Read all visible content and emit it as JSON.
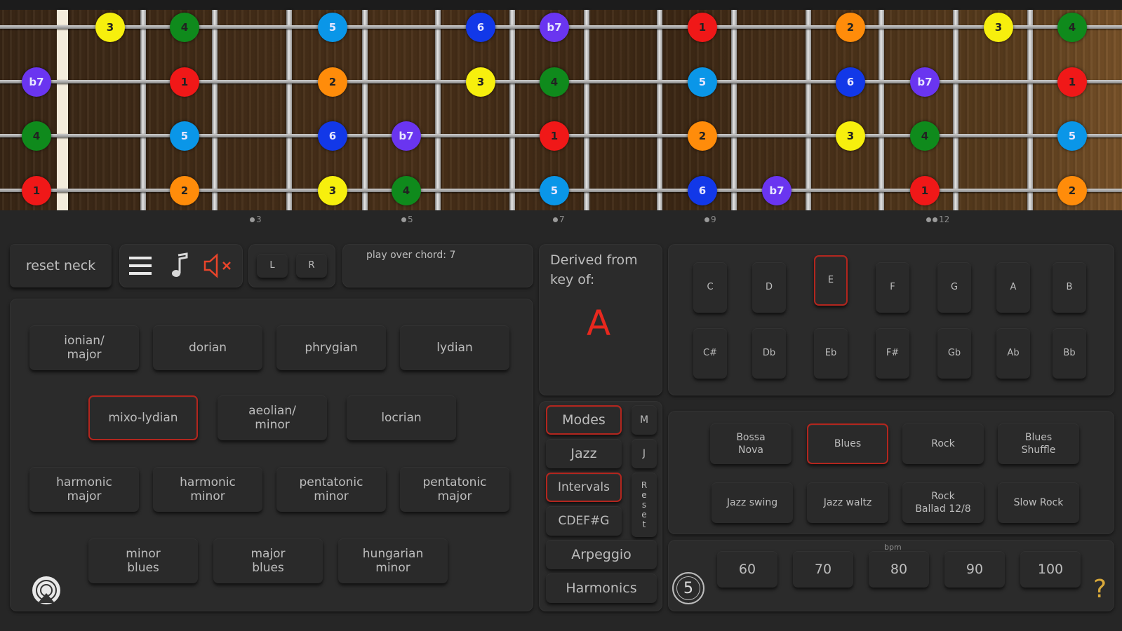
{
  "fret_markers": [
    "3",
    "5",
    "7",
    "9",
    "12"
  ],
  "strings": [
    {
      "notes": [
        {
          "label": "3",
          "color": "#f7ef0d"
        },
        {
          "label": "4",
          "color": "#0f8a1c"
        },
        {
          "label": "5",
          "color": "#0a96e8"
        },
        {
          "label": "6",
          "color": "#1238e8"
        },
        {
          "label": "b7",
          "color": "#6a35f0"
        },
        {
          "label": "1",
          "color": "#f01818"
        },
        {
          "label": "2",
          "color": "#ff8c0a"
        },
        {
          "label": "3",
          "color": "#f7ef0d"
        },
        {
          "label": "4",
          "color": "#0f8a1c"
        }
      ]
    },
    {
      "notes": [
        {
          "label": "b7",
          "color": "#6a35f0"
        },
        {
          "label": "1",
          "color": "#f01818"
        },
        {
          "label": "2",
          "color": "#ff8c0a"
        },
        {
          "label": "3",
          "color": "#f7ef0d"
        },
        {
          "label": "4",
          "color": "#0f8a1c"
        },
        {
          "label": "5",
          "color": "#0a96e8"
        },
        {
          "label": "6",
          "color": "#1238e8"
        },
        {
          "label": "b7",
          "color": "#6a35f0"
        },
        {
          "label": "1",
          "color": "#f01818"
        }
      ]
    },
    {
      "notes": [
        {
          "label": "4",
          "color": "#0f8a1c"
        },
        {
          "label": "5",
          "color": "#0a96e8"
        },
        {
          "label": "6",
          "color": "#1238e8"
        },
        {
          "label": "b7",
          "color": "#6a35f0"
        },
        {
          "label": "1",
          "color": "#f01818"
        },
        {
          "label": "2",
          "color": "#ff8c0a"
        },
        {
          "label": "3",
          "color": "#f7ef0d"
        },
        {
          "label": "4",
          "color": "#0f8a1c"
        },
        {
          "label": "5",
          "color": "#0a96e8"
        }
      ]
    },
    {
      "notes": [
        {
          "label": "1",
          "color": "#f01818"
        },
        {
          "label": "2",
          "color": "#ff8c0a"
        },
        {
          "label": "3",
          "color": "#f7ef0d"
        },
        {
          "label": "4",
          "color": "#0f8a1c"
        },
        {
          "label": "5",
          "color": "#0a96e8"
        },
        {
          "label": "6",
          "color": "#1238e8"
        },
        {
          "label": "b7",
          "color": "#6a35f0"
        },
        {
          "label": "1",
          "color": "#f01818"
        },
        {
          "label": "2",
          "color": "#ff8c0a"
        }
      ]
    }
  ],
  "controls": {
    "reset_neck": "reset neck",
    "left": "L",
    "right": "R",
    "play_over": "play over chord: 7"
  },
  "derived": {
    "line1": "Derived from",
    "line2": "key of:",
    "key": "A"
  },
  "scales": [
    "ionian/\nmajor",
    "dorian",
    "phrygian",
    "lydian",
    "mixo-lydian",
    "aeolian/\nminor",
    "locrian",
    "harmonic\nmajor",
    "harmonic\nminor",
    "pentatonic\nminor",
    "pentatonic\nmajor",
    "minor\nblues",
    "major\nblues",
    "hungarian\nminor"
  ],
  "modes": {
    "modes": "Modes",
    "jazz": "Jazz",
    "intervals": "Intervals",
    "cdefg": "CDEF#G",
    "arpeggio": "Arpeggio",
    "harmonics": "Harmonics",
    "m": "M",
    "j": "J",
    "reset": "R\ne\ns\ne\nt"
  },
  "keys_row1": [
    "C",
    "D",
    "E",
    "F",
    "G",
    "A",
    "B"
  ],
  "keys_row2": [
    "C#",
    "Db",
    "Eb",
    "F#",
    "Gb",
    "Ab",
    "Bb"
  ],
  "styles_row1": [
    "Bossa\nNova",
    "Blues",
    "Rock",
    "Blues\nShuffle"
  ],
  "styles_row2": [
    "Jazz swing",
    "Jazz waltz",
    "Rock\nBallad 12/8",
    "Slow Rock"
  ],
  "tempo": {
    "label": "bpm",
    "values": [
      "60",
      "70",
      "80",
      "90",
      "100"
    ],
    "count": "5",
    "help": "?"
  },
  "colors": {
    "accent": "#b3261e",
    "key_color": "#e8281e",
    "speaker": "#e8442a"
  }
}
